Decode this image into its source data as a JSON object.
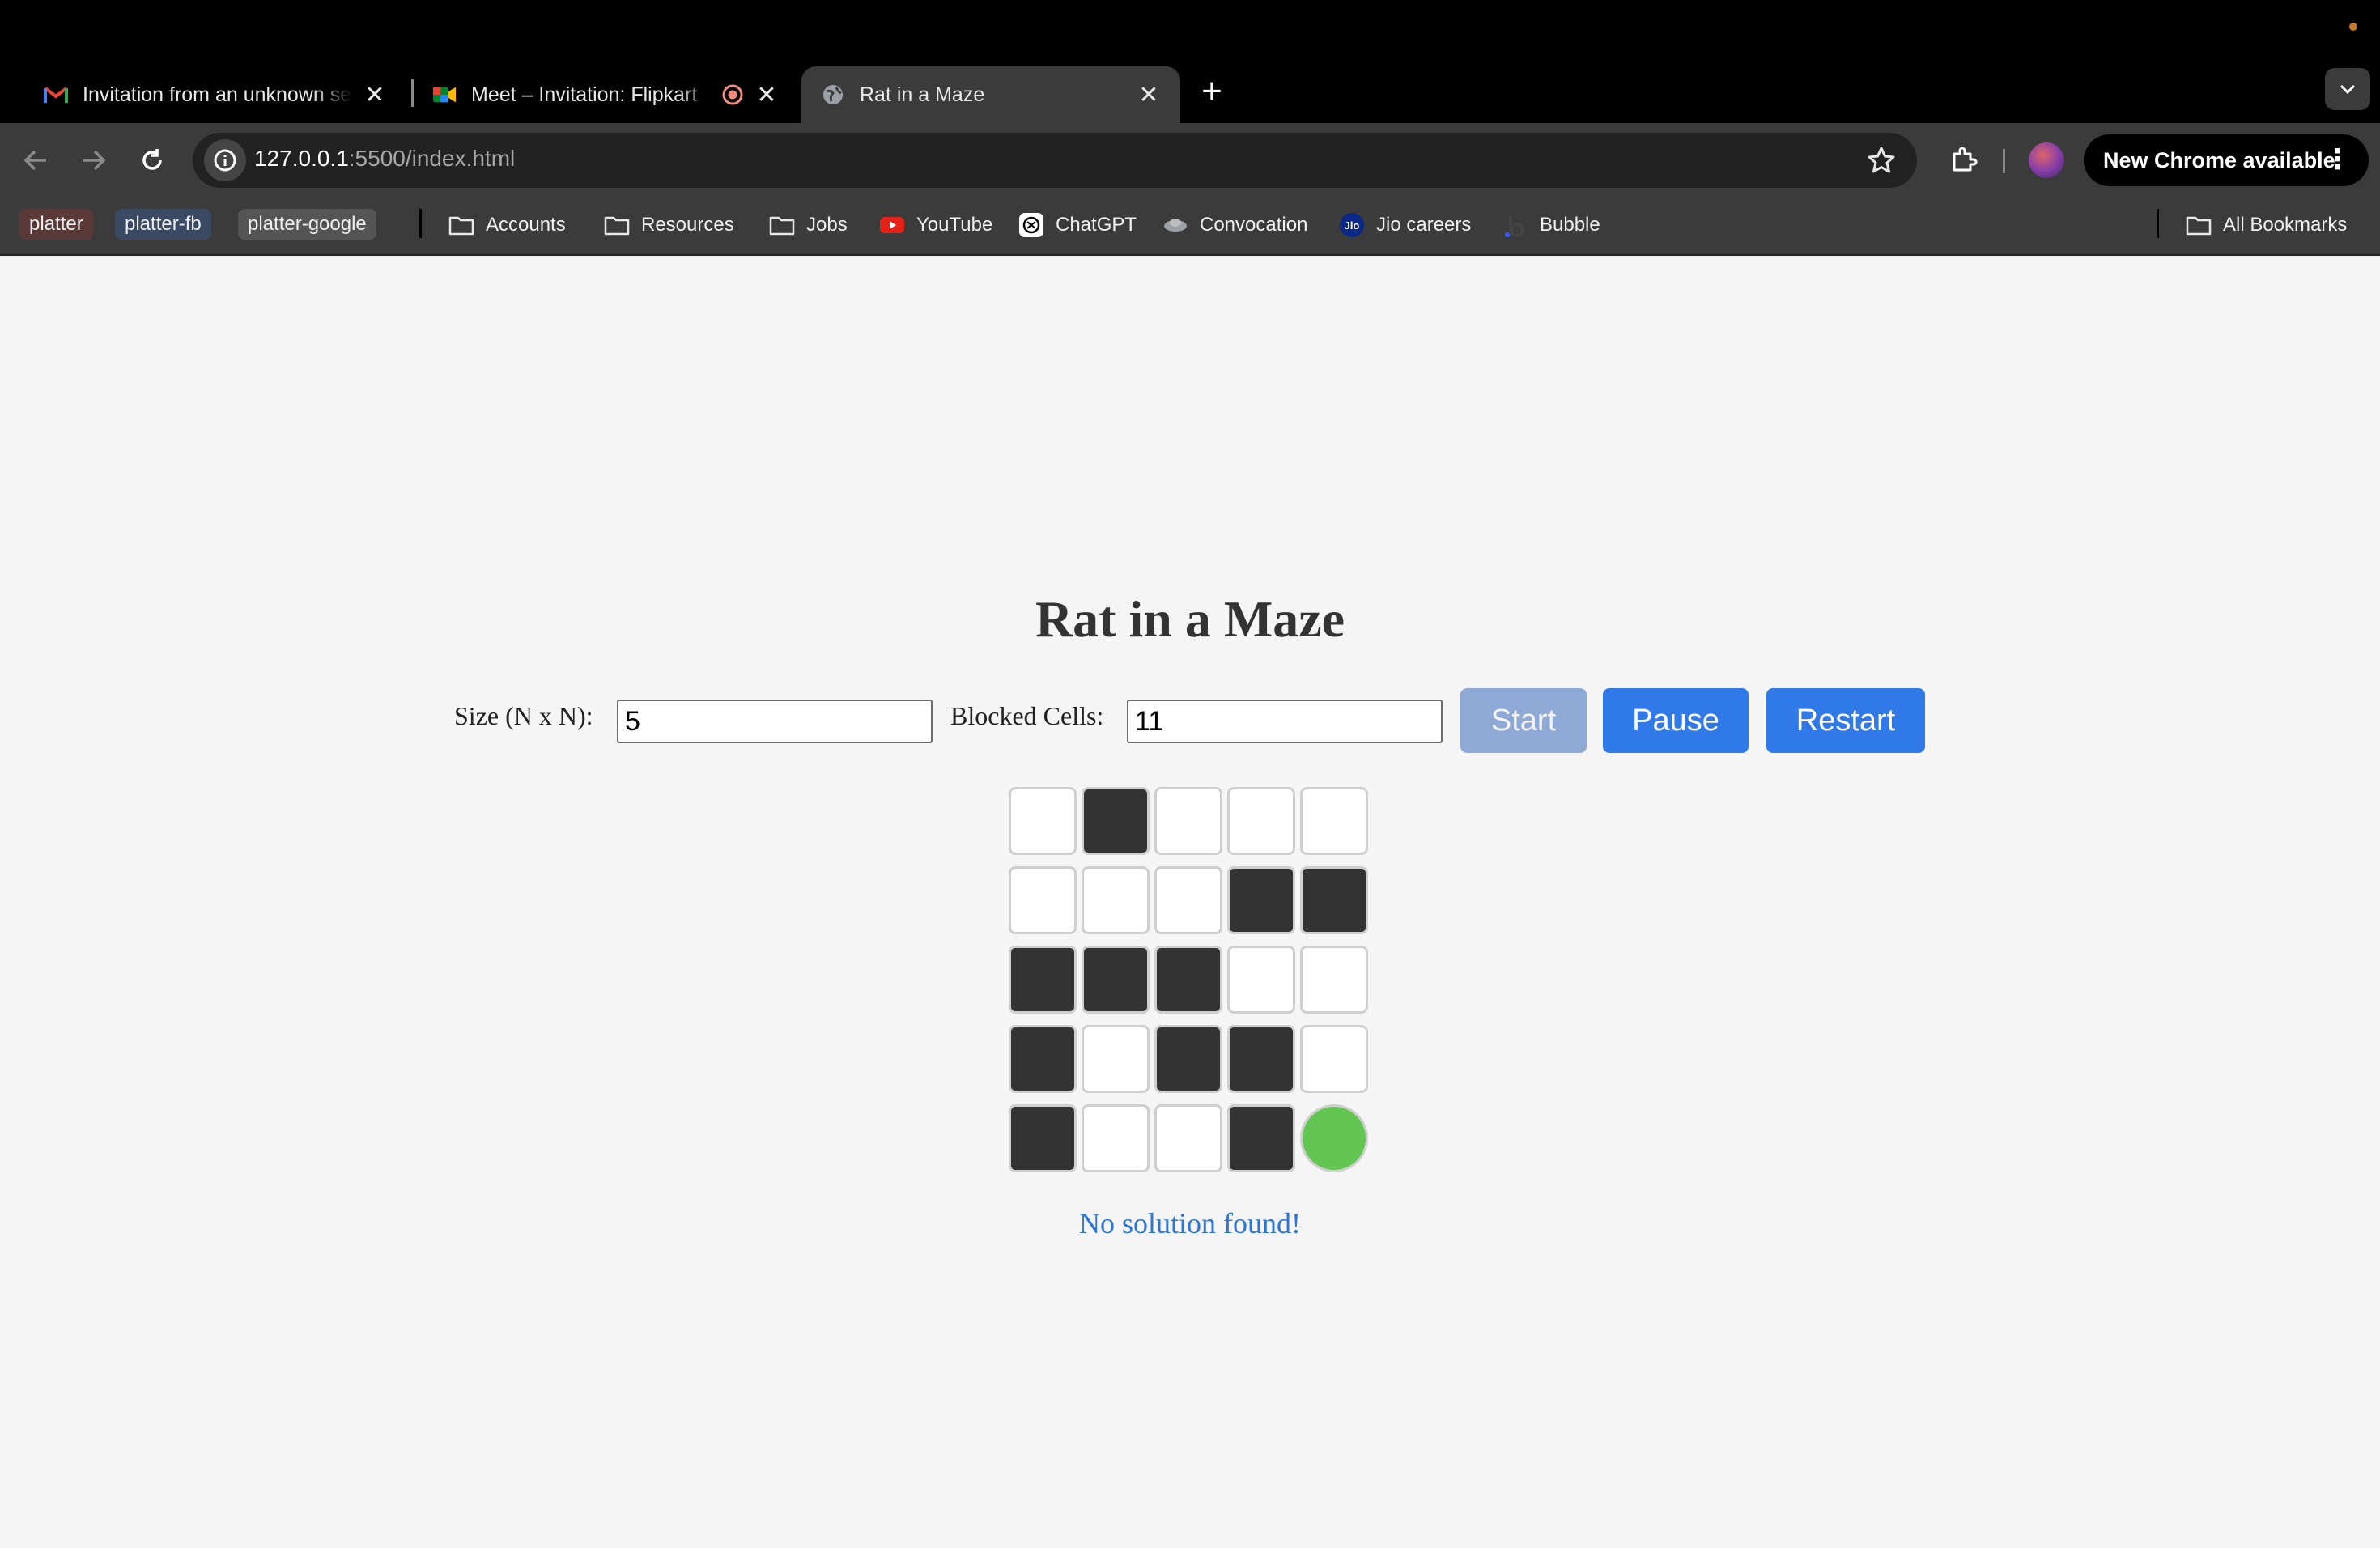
{
  "browser": {
    "tabs": [
      {
        "title": "Invitation from an unknown se",
        "icon": "gmail-icon",
        "active": false
      },
      {
        "title": "Meet – Invitation: Flipkart",
        "icon": "google-meet-icon",
        "recording": true,
        "active": false
      },
      {
        "title": "Rat in a Maze",
        "icon": "globe-icon",
        "active": true
      }
    ],
    "url_host": "127.0.0.1",
    "url_path": ":5500/index.html",
    "update_label": "New Chrome available",
    "bookmark_chips": [
      {
        "label": "platter",
        "color": "#5a3a38"
      },
      {
        "label": "platter-fb",
        "color": "#3a4a62"
      },
      {
        "label": "platter-google",
        "color": "#555555"
      }
    ],
    "bookmarks": [
      {
        "label": "Accounts",
        "icon": "folder-icon"
      },
      {
        "label": "Resources",
        "icon": "folder-icon"
      },
      {
        "label": "Jobs",
        "icon": "folder-icon"
      },
      {
        "label": "YouTube",
        "icon": "youtube-icon"
      },
      {
        "label": "ChatGPT",
        "icon": "chatgpt-icon"
      },
      {
        "label": "Convocation",
        "icon": "cap-icon"
      },
      {
        "label": "Jio careers",
        "icon": "jio-icon"
      },
      {
        "label": "Bubble",
        "icon": "bubble-icon"
      }
    ],
    "all_bookmarks_label": "All Bookmarks"
  },
  "app": {
    "title": "Rat in a Maze",
    "size_label": "Size (N x N):",
    "size_value": "5",
    "blocked_label": "Blocked Cells:",
    "blocked_value": "11",
    "start_label": "Start",
    "pause_label": "Pause",
    "restart_label": "Restart",
    "status": "No solution found!",
    "colors": {
      "primary": "#3079e8",
      "disabled": "#8fa9d6",
      "blocked": "#333333",
      "open": "#ffffff",
      "rat": "#63c653",
      "status": "#2d75d6"
    },
    "maze": [
      [
        0,
        1,
        0,
        0,
        0
      ],
      [
        0,
        0,
        0,
        1,
        1
      ],
      [
        1,
        1,
        1,
        0,
        0
      ],
      [
        1,
        0,
        1,
        1,
        0
      ],
      [
        1,
        0,
        0,
        1,
        2
      ]
    ]
  }
}
